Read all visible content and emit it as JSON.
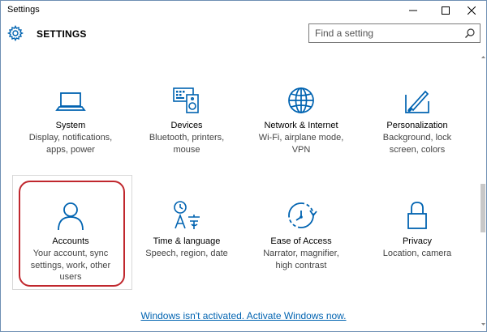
{
  "window": {
    "title": "Settings"
  },
  "header": {
    "title": "SETTINGS",
    "search_placeholder": "Find a setting"
  },
  "colors": {
    "accent": "#0063b1",
    "highlight_ring": "#c0272d"
  },
  "tiles": [
    {
      "name": "System",
      "desc": [
        "Display, notifications,",
        "apps, power"
      ],
      "icon": "laptop-icon"
    },
    {
      "name": "Devices",
      "desc": [
        "Bluetooth, printers,",
        "mouse"
      ],
      "icon": "devices-icon"
    },
    {
      "name": "Network & Internet",
      "desc": [
        "Wi-Fi, airplane mode,",
        "VPN"
      ],
      "icon": "globe-icon"
    },
    {
      "name": "Personalization",
      "desc": [
        "Background, lock",
        "screen, colors"
      ],
      "icon": "paint-icon"
    },
    {
      "name": "Accounts",
      "desc": [
        "Your account, sync",
        "settings, work, other",
        "users"
      ],
      "icon": "person-icon"
    },
    {
      "name": "Time & language",
      "desc": [
        "Speech, region, date"
      ],
      "icon": "time-language-icon"
    },
    {
      "name": "Ease of Access",
      "desc": [
        "Narrator, magnifier,",
        "high contrast"
      ],
      "icon": "ease-of-access-icon"
    },
    {
      "name": "Privacy",
      "desc": [
        "Location, camera"
      ],
      "icon": "lock-icon"
    }
  ],
  "footer": {
    "activate_link": "Windows isn't activated. Activate Windows now."
  }
}
